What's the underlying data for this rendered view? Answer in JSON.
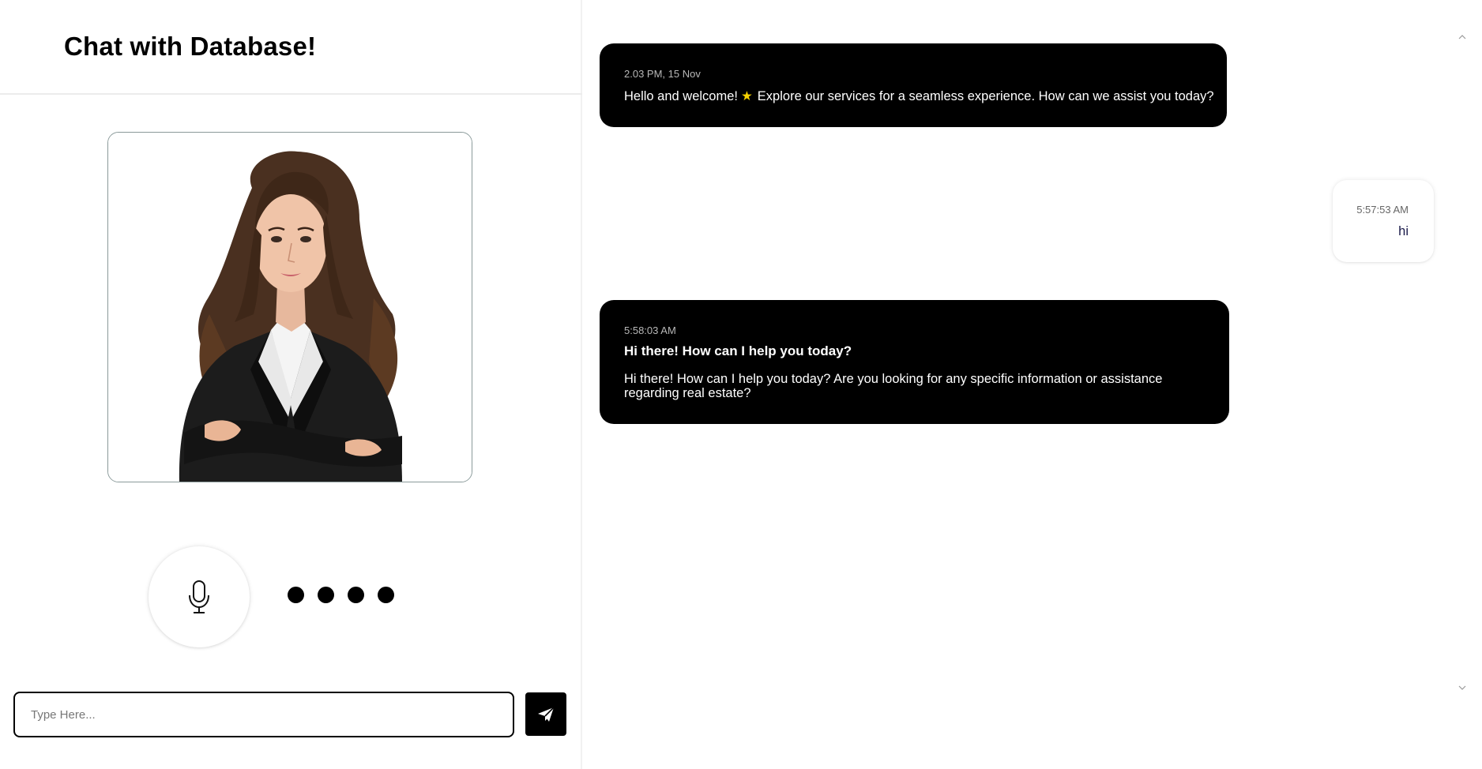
{
  "header": {
    "title": "Chat with Database!"
  },
  "input": {
    "placeholder": "Type Here...",
    "value": ""
  },
  "controls": {
    "mic_icon": "microphone-icon",
    "send_icon": "paper-plane-icon",
    "typing_indicator_dots": 4
  },
  "chat": {
    "messages": [
      {
        "sender": "bot",
        "timestamp": "2.03 PM, 15 Nov",
        "text_before_icon": "Hello and welcome!",
        "icon": "star-icon",
        "text_after_icon": "Explore our services for a seamless experience. How can we assist you today?"
      },
      {
        "sender": "user",
        "timestamp": "5:57:53 AM",
        "text": "hi"
      },
      {
        "sender": "bot",
        "timestamp": "5:58:03 AM",
        "heading": "Hi there! How can I help you today?",
        "text": "Hi there! How can I help you today? Are you looking for any specific information or assistance regarding real estate?"
      }
    ]
  },
  "colors": {
    "bot_bubble_bg": "#000000",
    "bot_text": "#ffffff",
    "user_bubble_bg": "#ffffff",
    "accent_star": "#f5d100",
    "send_button_bg": "#000000"
  }
}
